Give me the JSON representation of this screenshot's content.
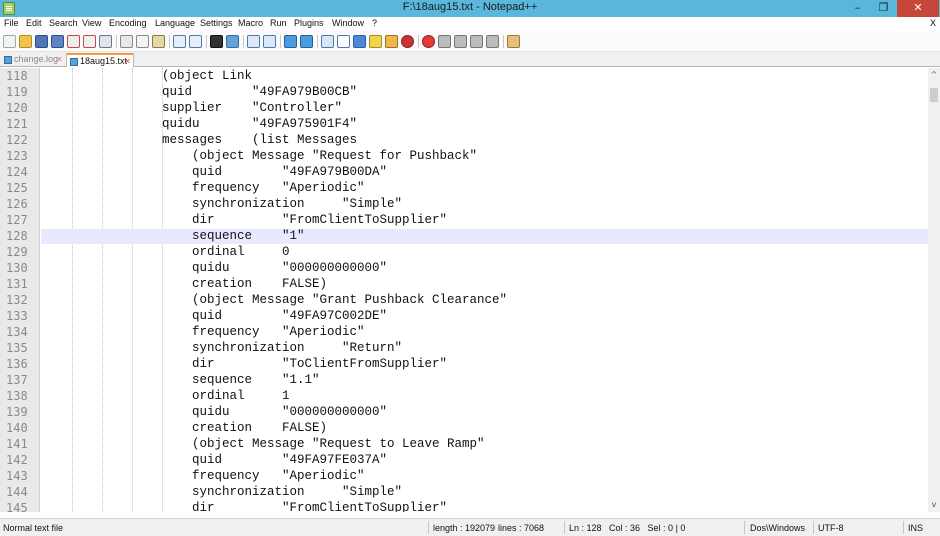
{
  "window": {
    "title": "F:\\18aug15.txt - Notepad++",
    "minimize_glyph": "–",
    "maximize_glyph": "❐",
    "close_glyph": "✕",
    "menu_close_glyph": "X"
  },
  "menu": [
    "File",
    "Edit",
    "Search",
    "View",
    "Encoding",
    "Language",
    "Settings",
    "Macro",
    "Run",
    "Plugins",
    "Window",
    "?"
  ],
  "tabs": [
    {
      "label": "change.log",
      "active": false,
      "close": "✕"
    },
    {
      "label": "18aug15.txt",
      "active": true,
      "close": "✕"
    }
  ],
  "editor": {
    "lines": [
      {
        "num": "118",
        "text": "(object Link"
      },
      {
        "num": "119",
        "text": "quid        \"49FA979B00CB\""
      },
      {
        "num": "120",
        "text": "supplier    \"Controller\""
      },
      {
        "num": "121",
        "text": "quidu       \"49FA975901F4\""
      },
      {
        "num": "122",
        "text": "messages    (list Messages"
      },
      {
        "num": "123",
        "text": "(object Message \"Request for Pushback\""
      },
      {
        "num": "124",
        "text": "quid        \"49FA979B00DA\""
      },
      {
        "num": "125",
        "text": "frequency   \"Aperiodic\""
      },
      {
        "num": "126",
        "text": "synchronization     \"Simple\""
      },
      {
        "num": "127",
        "text": "dir         \"FromClientToSupplier\""
      },
      {
        "num": "128",
        "text": "sequence    \"1\""
      },
      {
        "num": "129",
        "text": "ordinal     0"
      },
      {
        "num": "130",
        "text": "quidu       \"000000000000\""
      },
      {
        "num": "131",
        "text": "creation    FALSE)"
      },
      {
        "num": "132",
        "text": "(object Message \"Grant Pushback Clearance\""
      },
      {
        "num": "133",
        "text": "quid        \"49FA97C002DE\""
      },
      {
        "num": "134",
        "text": "frequency   \"Aperiodic\""
      },
      {
        "num": "135",
        "text": "synchronization     \"Return\""
      },
      {
        "num": "136",
        "text": "dir         \"ToClientFromSupplier\""
      },
      {
        "num": "137",
        "text": "sequence    \"1.1\""
      },
      {
        "num": "138",
        "text": "ordinal     1"
      },
      {
        "num": "139",
        "text": "quidu       \"000000000000\""
      },
      {
        "num": "140",
        "text": "creation    FALSE)"
      },
      {
        "num": "141",
        "text": "(object Message \"Request to Leave Ramp\""
      },
      {
        "num": "142",
        "text": "quid        \"49FA97FE037A\""
      },
      {
        "num": "143",
        "text": "frequency   \"Aperiodic\""
      },
      {
        "num": "144",
        "text": "synchronization     \"Simple\""
      },
      {
        "num": "145",
        "text": "dir         \"FromClientToSupplier\""
      }
    ]
  },
  "scrollbar": {
    "up_glyph": "^",
    "down_glyph": "v"
  },
  "status": {
    "file_type": "Normal text file",
    "length": "length : 192079",
    "lines": "lines : 7068",
    "position": "Ln : 128   Col : 36   Sel : 0 | 0",
    "eol": "Dos\\Windows",
    "encoding": "UTF-8",
    "mode": "INS"
  }
}
